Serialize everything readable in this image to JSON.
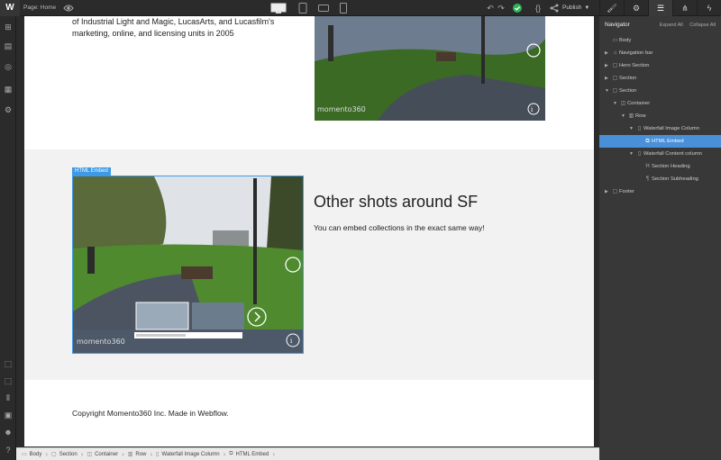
{
  "app": {
    "logo": "W",
    "page_label": "Page: Home",
    "publish_label": "Publish",
    "right_tabs": [
      "brush-icon",
      "gear-icon",
      "navigator-icon",
      "interactions-icon",
      "lightning-icon"
    ],
    "devices": [
      "desktop",
      "tablet",
      "mobile-landscape",
      "mobile-portrait"
    ],
    "active_device": "desktop",
    "accent": "#3d9ae8",
    "publish_status_color": "#2fb35a"
  },
  "canvas": {
    "intro_text": "of Industrial Light and Magic, LucasArts, and Lucasfilm's marketing, online, and licensing units in 2005",
    "embed_tag": "HTML Embed",
    "embed_logo": "momento360",
    "section_title": "Other shots around SF",
    "section_subtitle": "You can embed collections in the exact same way!",
    "footer_text": "Copyright Momento360 Inc. Made in Webflow."
  },
  "navigator": {
    "title": "Navigator",
    "expand_all": "Expand All",
    "collapse_all": "Collapse All",
    "items": [
      {
        "label": "Body",
        "depth": 0,
        "arrow": "",
        "icon": "body-icon",
        "selected": false
      },
      {
        "label": "Navigation bar",
        "depth": 0,
        "arrow": "▶",
        "icon": "nav-icon",
        "selected": false
      },
      {
        "label": "Hero Section",
        "depth": 0,
        "arrow": "▶",
        "icon": "section-icon",
        "selected": false
      },
      {
        "label": "Section",
        "depth": 0,
        "arrow": "▶",
        "icon": "section-icon",
        "selected": false
      },
      {
        "label": "Section",
        "depth": 0,
        "arrow": "▼",
        "icon": "section-icon",
        "selected": false
      },
      {
        "label": "Container",
        "depth": 1,
        "arrow": "▼",
        "icon": "container-icon",
        "selected": false
      },
      {
        "label": "Row",
        "depth": 2,
        "arrow": "▼",
        "icon": "row-icon",
        "selected": false
      },
      {
        "label": "Waterfall Image Column",
        "depth": 3,
        "arrow": "▼",
        "icon": "column-icon",
        "selected": false
      },
      {
        "label": "HTML Embed",
        "depth": 4,
        "arrow": "",
        "icon": "embed-icon",
        "selected": true
      },
      {
        "label": "Waterfall Content column",
        "depth": 3,
        "arrow": "▼",
        "icon": "column-icon",
        "selected": false
      },
      {
        "label": "Section Heading",
        "depth": 4,
        "arrow": "",
        "icon": "heading-icon",
        "selected": false
      },
      {
        "label": "Section Subheading",
        "depth": 4,
        "arrow": "",
        "icon": "paragraph-icon",
        "selected": false
      },
      {
        "label": "Footer",
        "depth": 0,
        "arrow": "▶",
        "icon": "section-icon",
        "selected": false
      }
    ]
  },
  "breadcrumb": [
    {
      "label": "Body",
      "icon": "body-icon"
    },
    {
      "label": "Section",
      "icon": "section-icon"
    },
    {
      "label": "Container",
      "icon": "container-icon"
    },
    {
      "label": "Row",
      "icon": "row-icon"
    },
    {
      "label": "Waterfall Image Column",
      "icon": "column-icon"
    },
    {
      "label": "HTML Embed",
      "icon": "embed-icon"
    }
  ]
}
